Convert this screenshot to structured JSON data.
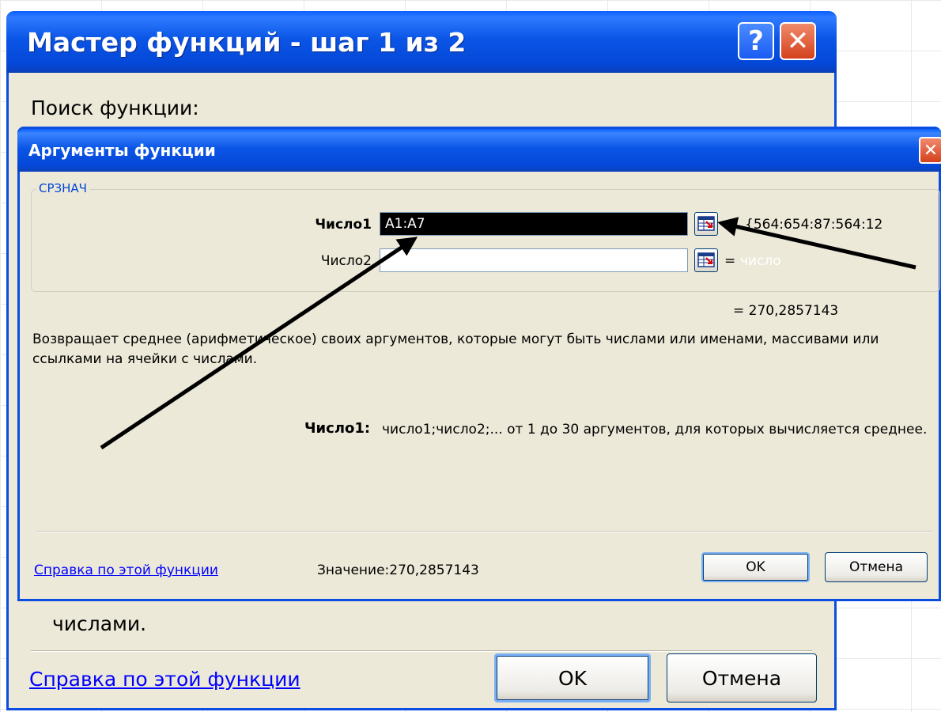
{
  "wizard": {
    "title": "Мастер функций - шаг 1 из 2",
    "help_button": "?",
    "close_button": "✕",
    "search_label": "Поиск функции:",
    "description_tail": "числами.",
    "help_link": "Справка по этой функции",
    "ok": "OK",
    "cancel": "Отмена"
  },
  "args_dialog": {
    "title": "Аргументы функции",
    "close_button": "✕",
    "function_name": "СРЗНАЧ",
    "args": [
      {
        "label": "Число1",
        "value": "A1:A7",
        "result": "{564:654:87:564:12",
        "bold": true
      },
      {
        "label": "Число2",
        "value": "",
        "result": "число",
        "bold": false
      }
    ],
    "result_line": "= 270,2857143",
    "description": "Возвращает среднее (арифметическое) своих аргументов, которые могут быть числами или именами, массивами или ссылками на ячейки с числами.",
    "arg_desc_name": "Число1:",
    "arg_desc_text": "число1;число2;... от 1 до 30 аргументов, для которых вычисляется среднее.",
    "help_link": "Справка по этой функции",
    "value_label": "Значение:",
    "value": "270,2857143",
    "ok": "OK",
    "cancel": "Отмена"
  },
  "colors": {
    "title_blue": "#0b55e6",
    "dialog_bg": "#ece9d8",
    "link_blue": "#0000ff",
    "close_red": "#d4411c"
  }
}
